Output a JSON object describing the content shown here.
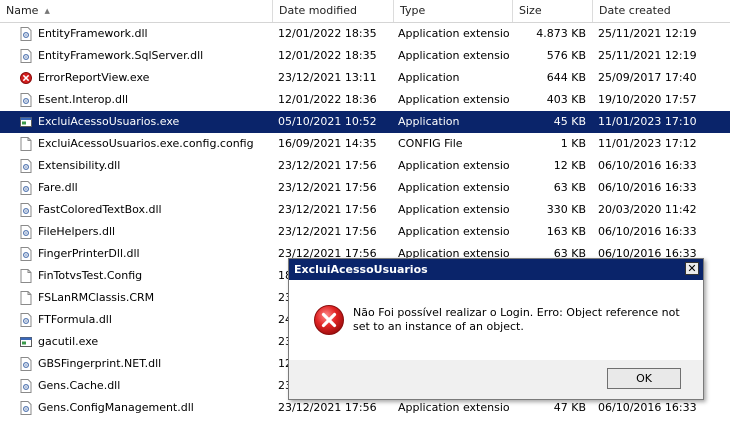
{
  "columns": {
    "name": "Name",
    "date_modified": "Date modified",
    "type": "Type",
    "size": "Size",
    "date_created": "Date created"
  },
  "files": [
    {
      "name": "EntityFramework.dll",
      "modified": "12/01/2022 18:35",
      "type": "Application extension",
      "size": "4.873 KB",
      "created": "25/11/2021 12:19",
      "icon": "dll-icon"
    },
    {
      "name": "EntityFramework.SqlServer.dll",
      "modified": "12/01/2022 18:35",
      "type": "Application extension",
      "size": "576 KB",
      "created": "25/11/2021 12:19",
      "icon": "dll-icon"
    },
    {
      "name": "ErrorReportView.exe",
      "modified": "23/12/2021 13:11",
      "type": "Application",
      "size": "644 KB",
      "created": "25/09/2017 17:40",
      "icon": "error-app-icon"
    },
    {
      "name": "Esent.Interop.dll",
      "modified": "12/01/2022 18:36",
      "type": "Application extension",
      "size": "403 KB",
      "created": "19/10/2020 17:57",
      "icon": "dll-icon"
    },
    {
      "name": "ExcluiAcessoUsuarios.exe",
      "modified": "05/10/2021 10:52",
      "type": "Application",
      "size": "45 KB",
      "created": "11/01/2023 17:10",
      "icon": "exe-icon",
      "selected": true
    },
    {
      "name": "ExcluiAcessoUsuarios.exe.config.config",
      "modified": "16/09/2021 14:35",
      "type": "CONFIG File",
      "size": "1 KB",
      "created": "11/01/2023 17:12",
      "icon": "file-icon"
    },
    {
      "name": "Extensibility.dll",
      "modified": "23/12/2021 17:56",
      "type": "Application extension",
      "size": "12 KB",
      "created": "06/10/2016 16:33",
      "icon": "dll-icon"
    },
    {
      "name": "Fare.dll",
      "modified": "23/12/2021 17:56",
      "type": "Application extension",
      "size": "63 KB",
      "created": "06/10/2016 16:33",
      "icon": "dll-icon"
    },
    {
      "name": "FastColoredTextBox.dll",
      "modified": "23/12/2021 17:56",
      "type": "Application extension",
      "size": "330 KB",
      "created": "20/03/2020 11:42",
      "icon": "dll-icon"
    },
    {
      "name": "FileHelpers.dll",
      "modified": "23/12/2021 17:56",
      "type": "Application extension",
      "size": "163 KB",
      "created": "06/10/2016 16:33",
      "icon": "dll-icon"
    },
    {
      "name": "FingerPrinterDll.dll",
      "modified": "23/12/2021 17:56",
      "type": "Application extension",
      "size": "63 KB",
      "created": "06/10/2016 16:33",
      "icon": "dll-icon"
    },
    {
      "name": "FinTotvsTest.Config",
      "modified": "18",
      "type": "",
      "size": "",
      "created": "",
      "icon": "file-icon"
    },
    {
      "name": "FSLanRMClassis.CRM",
      "modified": "23",
      "type": "",
      "size": "",
      "created": "",
      "icon": "file-icon"
    },
    {
      "name": "FTFormula.dll",
      "modified": "24",
      "type": "",
      "size": "",
      "created": "",
      "icon": "dll-icon"
    },
    {
      "name": "gacutil.exe",
      "modified": "23",
      "type": "",
      "size": "",
      "created": "",
      "icon": "exe-icon"
    },
    {
      "name": "GBSFingerprint.NET.dll",
      "modified": "12",
      "type": "",
      "size": "",
      "created": "",
      "icon": "dll-icon"
    },
    {
      "name": "Gens.Cache.dll",
      "modified": "23",
      "type": "",
      "size": "",
      "created": "",
      "icon": "dll-icon"
    },
    {
      "name": "Gens.ConfigManagement.dll",
      "modified": "23/12/2021 17:56",
      "type": "Application extension",
      "size": "47 KB",
      "created": "06/10/2016 16:33",
      "icon": "dll-icon"
    }
  ],
  "dialog": {
    "title": "ExcluiAcessoUsuarios",
    "message": "Não Foi possível realizar o Login. Erro: Object reference not set to an instance of an object.",
    "ok_label": "OK",
    "close_glyph": "✕",
    "icon": "error-icon"
  },
  "colors": {
    "selection": "#0a246a",
    "title_bar": "#0a246a",
    "error_red": "#d42020"
  }
}
